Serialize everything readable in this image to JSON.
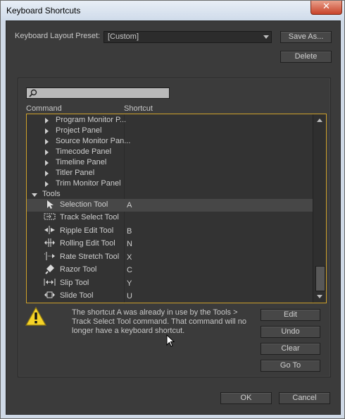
{
  "window": {
    "title": "Keyboard Shortcuts",
    "close_label": "✕"
  },
  "preset": {
    "label": "Keyboard Layout Preset:",
    "value": "[Custom]",
    "save_as": "Save As...",
    "delete": "Delete"
  },
  "columns": {
    "command": "Command",
    "shortcut": "Shortcut"
  },
  "rows": [
    {
      "label": "Program Monitor P...",
      "shortcut": "",
      "type": "group",
      "expanded": false
    },
    {
      "label": "Project Panel",
      "shortcut": "",
      "type": "group",
      "expanded": false
    },
    {
      "label": "Source Monitor Pan...",
      "shortcut": "",
      "type": "group",
      "expanded": false
    },
    {
      "label": "Timecode Panel",
      "shortcut": "",
      "type": "group",
      "expanded": false
    },
    {
      "label": "Timeline Panel",
      "shortcut": "",
      "type": "group",
      "expanded": false
    },
    {
      "label": "Titler Panel",
      "shortcut": "",
      "type": "group",
      "expanded": false
    },
    {
      "label": "Trim Monitor Panel",
      "shortcut": "",
      "type": "group",
      "expanded": false
    },
    {
      "label": "Tools",
      "shortcut": "",
      "type": "root",
      "expanded": true
    },
    {
      "label": "Selection Tool",
      "shortcut": "A",
      "type": "tool",
      "icon": "selection-tool-icon",
      "selected": true
    },
    {
      "label": "Track Select Tool",
      "shortcut": "",
      "type": "tool",
      "icon": "track-select-tool-icon"
    },
    {
      "label": "Ripple Edit Tool",
      "shortcut": "B",
      "type": "tool",
      "icon": "ripple-edit-tool-icon"
    },
    {
      "label": "Rolling Edit Tool",
      "shortcut": "N",
      "type": "tool",
      "icon": "rolling-edit-tool-icon"
    },
    {
      "label": "Rate Stretch Tool",
      "shortcut": "X",
      "type": "tool",
      "icon": "rate-stretch-tool-icon"
    },
    {
      "label": "Razor Tool",
      "shortcut": "C",
      "type": "tool",
      "icon": "razor-tool-icon"
    },
    {
      "label": "Slip Tool",
      "shortcut": "Y",
      "type": "tool",
      "icon": "slip-tool-icon"
    },
    {
      "label": "Slide Tool",
      "shortcut": "U",
      "type": "tool",
      "icon": "slide-tool-icon"
    }
  ],
  "message": "The shortcut A was already in use by the Tools > Track Select Tool command. That command will no longer have a keyboard shortcut.",
  "actions": {
    "edit": "Edit",
    "undo": "Undo",
    "clear": "Clear",
    "goto": "Go To"
  },
  "footer": {
    "ok": "OK",
    "cancel": "Cancel"
  },
  "colors": {
    "accent_border": "#d0a22b",
    "background": "#3b3b3b",
    "warning": "#f5d327"
  }
}
